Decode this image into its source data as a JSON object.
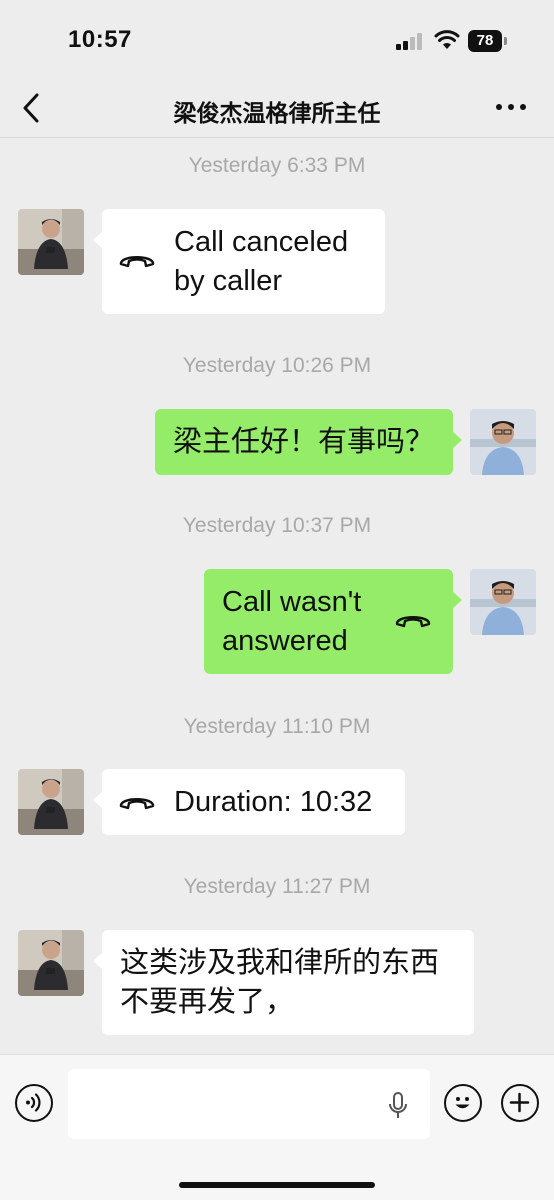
{
  "status": {
    "time": "10:57",
    "battery": "78"
  },
  "header": {
    "title": "梁俊杰温格律所主任"
  },
  "messages": [
    {
      "timestamp": "Yesterday 6:33 PM",
      "sender": "contact",
      "type": "call",
      "text": "Call canceled\nby caller"
    },
    {
      "timestamp": "Yesterday 10:26 PM",
      "sender": "me",
      "type": "text",
      "text": "梁主任好！有事吗？"
    },
    {
      "timestamp": "Yesterday 10:37 PM",
      "sender": "me",
      "type": "call",
      "text": "Call wasn't\nanswered"
    },
    {
      "timestamp": "Yesterday 11:10 PM",
      "sender": "contact",
      "type": "call",
      "text": "Duration: 10:32"
    },
    {
      "timestamp": "Yesterday 11:27 PM",
      "sender": "contact",
      "type": "text",
      "text": "这类涉及我和律所的东西\n不要再发了，"
    }
  ],
  "colors": {
    "background": "#ededed",
    "my_bubble": "#95ec69",
    "their_bubble": "#ffffff",
    "timestamp": "#a8a8a8"
  },
  "icons": {
    "back": "chevron-left-icon",
    "more": "more-dots-icon",
    "call": "phone-handset-icon",
    "voice": "voice-mode-icon",
    "mic": "microphone-icon",
    "emoji": "emoji-icon",
    "add": "plus-icon"
  }
}
